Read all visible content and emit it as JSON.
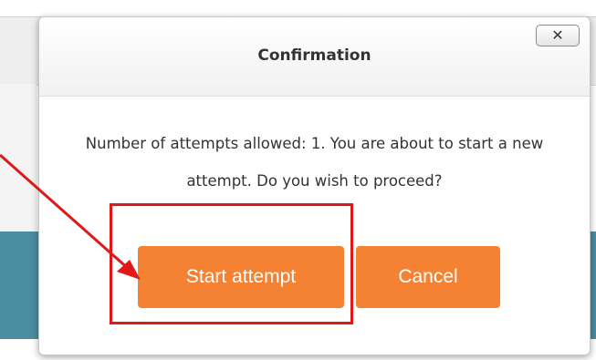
{
  "dialog": {
    "title": "Confirmation",
    "close_symbol": "✕",
    "message": "Number of attempts allowed: 1. You are about to start a new attempt. Do you wish to proceed?",
    "buttons": {
      "start_label": "Start attempt",
      "cancel_label": "Cancel"
    }
  },
  "colors": {
    "button_accent": "#f58233",
    "annotation_red": "#e01818",
    "background_teal": "#4a8da1"
  },
  "icons": {
    "close": "close-icon",
    "annotation": "arrow-icon"
  }
}
